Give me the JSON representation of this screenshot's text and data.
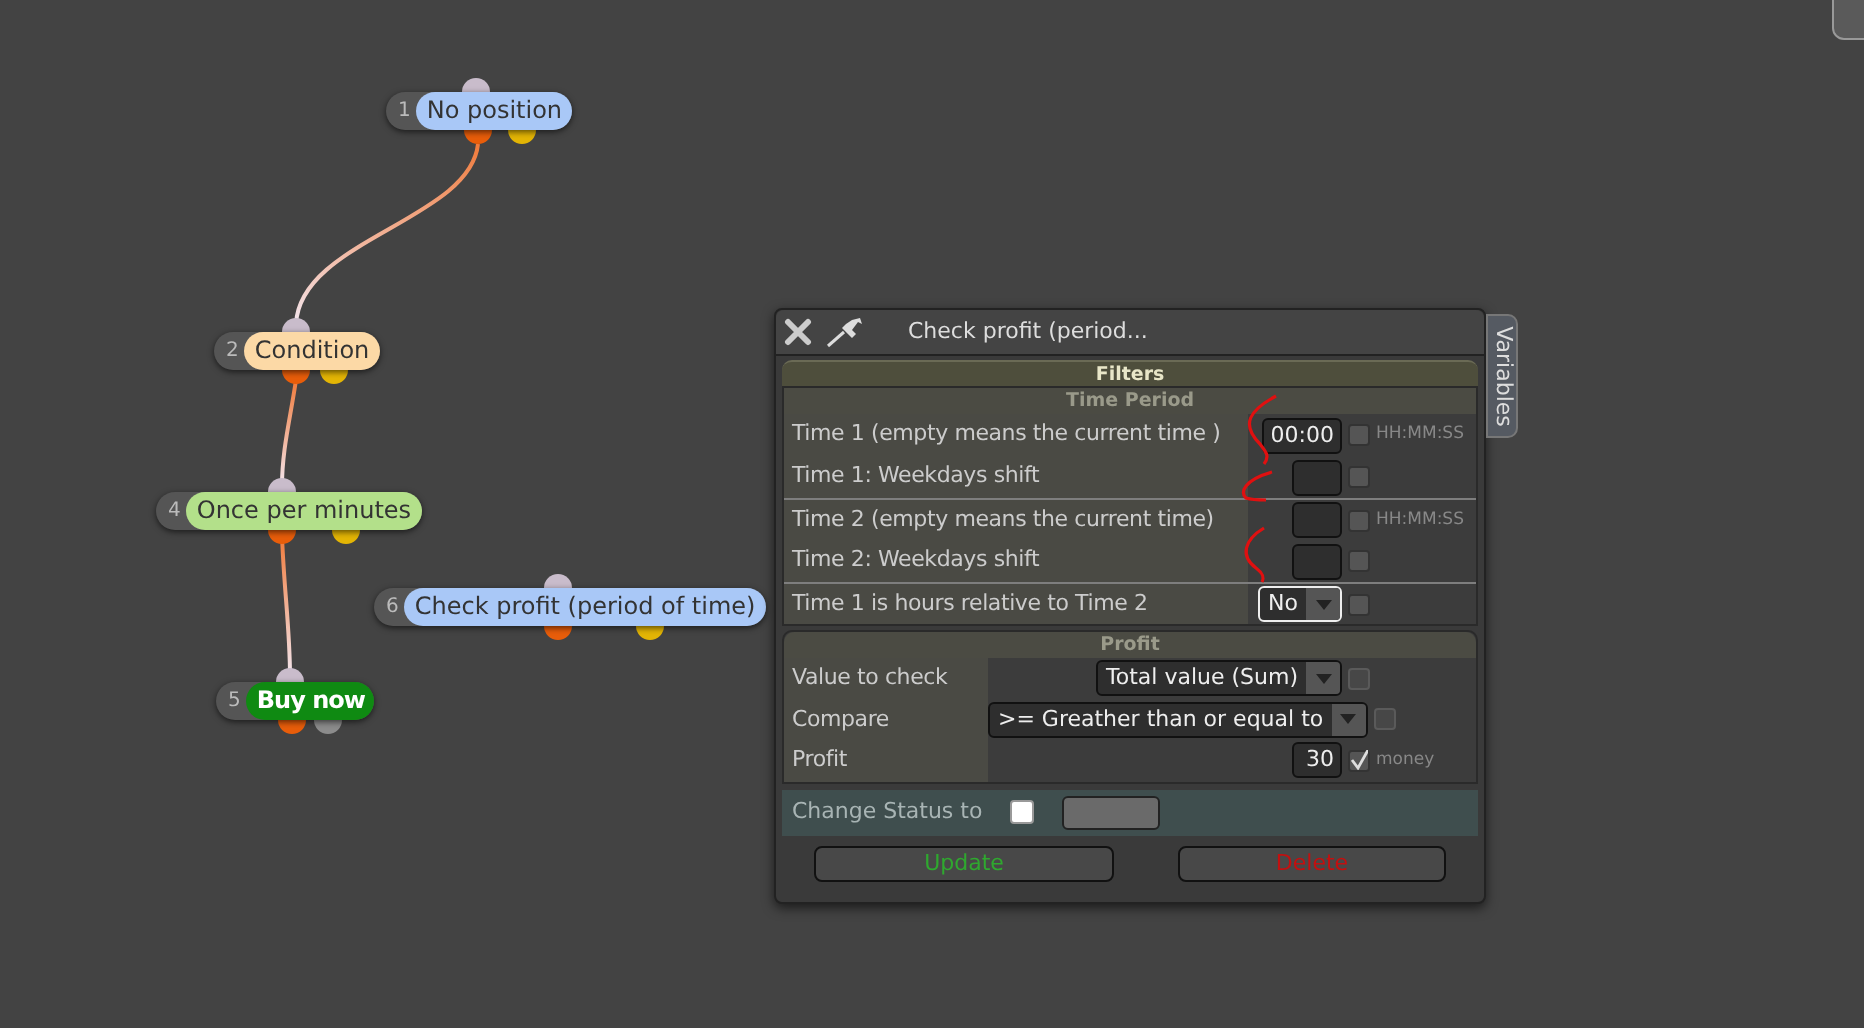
{
  "canvas": {
    "nodes": [
      {
        "number": "1",
        "label": "No position",
        "color": "#a9c8f7"
      },
      {
        "number": "2",
        "label": "Condition",
        "color": "#fcd9a6"
      },
      {
        "number": "4",
        "label": "Once per minutes",
        "color": "#b3e08a"
      },
      {
        "number": "6",
        "label": "Check profit (period of time)",
        "color": "#a9c8f7"
      },
      {
        "number": "5",
        "label": "Buy now",
        "color": "#0f8a12"
      }
    ]
  },
  "dialog": {
    "title": "Check profit (period...",
    "side_tab": "Variables",
    "section": "Filters",
    "groups": [
      {
        "title": "Time Period",
        "rows": [
          {
            "label": "Time 1 (empty means the current time )",
            "kind": "field",
            "value": "00:00",
            "checked": false,
            "unit": "HH:MM:SS"
          },
          {
            "label": "Time 1: Weekdays shift",
            "kind": "field",
            "checked": false
          },
          {
            "label": "Time 2 (empty means the current time)",
            "kind": "field",
            "checked": false,
            "unit": "HH:MM:SS"
          },
          {
            "label": "Time 2: Weekdays shift",
            "kind": "field",
            "checked": false
          },
          {
            "label": "Time 1 is hours relative to Time 2",
            "kind": "dropdown",
            "value": "No",
            "checked": false
          }
        ]
      },
      {
        "title": "Profit",
        "rows": [
          {
            "label": "Value to check",
            "kind": "dropdown",
            "value": "Total value (Sum)",
            "checked": false,
            "disabled": true
          },
          {
            "label": "Compare",
            "kind": "dropdown",
            "value": ">= Greather than or equal to",
            "checked": false,
            "disabled": true
          },
          {
            "label": "Profit",
            "kind": "field",
            "value": "30",
            "checked": true,
            "unit": "money"
          }
        ]
      }
    ],
    "status": {
      "label": "Change Status to",
      "checked": false
    },
    "buttons": [
      {
        "label": "Update",
        "kind": "update"
      },
      {
        "label": "Delete",
        "kind": "delete"
      }
    ]
  }
}
